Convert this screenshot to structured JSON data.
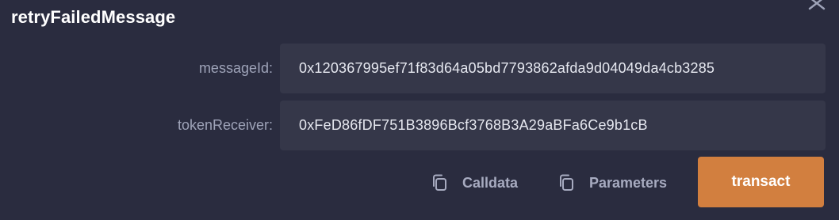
{
  "function": {
    "title": "retryFailedMessage"
  },
  "params": {
    "messageId": {
      "label": "messageId:",
      "value": "0x120367995ef71f83d64a05bd7793862afda9d04049da4cb3285"
    },
    "tokenReceiver": {
      "label": "tokenReceiver:",
      "value": "0xFeD86fDF751B3896Bcf3768B3A29aBFa6Ce9b1cB"
    }
  },
  "actions": {
    "calldata_label": "Calldata",
    "parameters_label": "Parameters",
    "transact_label": "transact"
  },
  "icons": {
    "close": "close-icon",
    "copy": "copy-icon"
  },
  "colors": {
    "background": "#2a2c3f",
    "field_background": "#353749",
    "accent": "#d27f3f",
    "label": "#9ea3b8"
  }
}
